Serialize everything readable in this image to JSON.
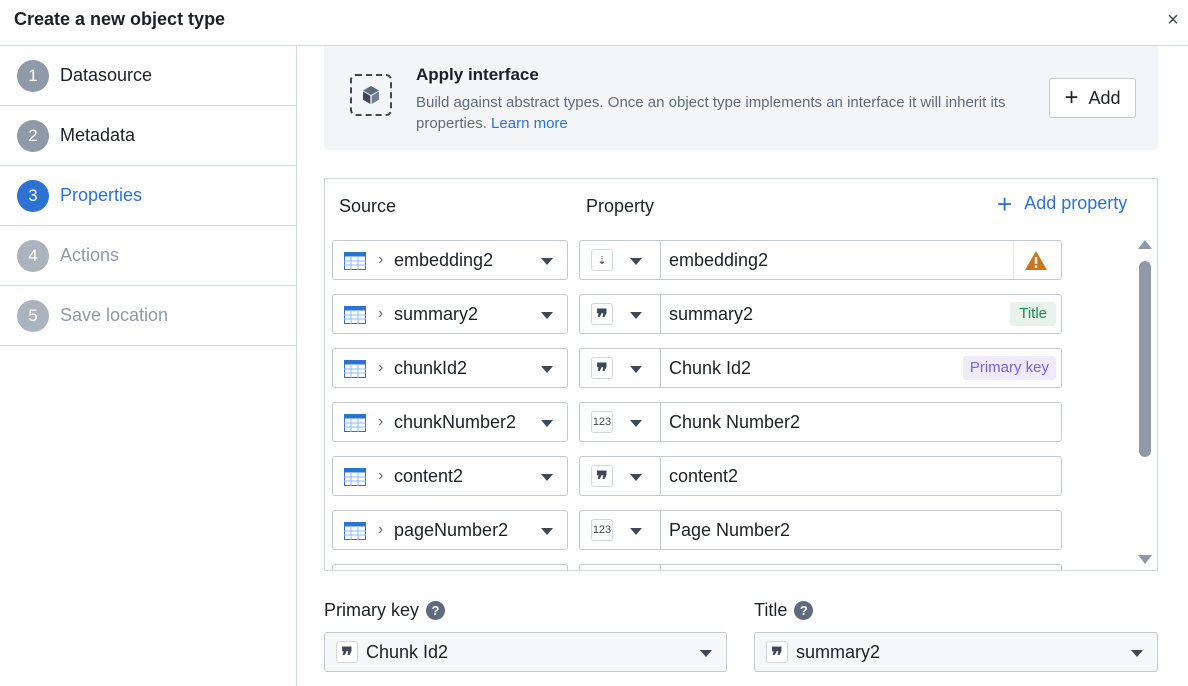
{
  "dialog": {
    "title": "Create a new object type",
    "close_glyph": "×"
  },
  "steps": [
    {
      "num": "1",
      "label": "Datasource",
      "state": "done"
    },
    {
      "num": "2",
      "label": "Metadata",
      "state": "done"
    },
    {
      "num": "3",
      "label": "Properties",
      "state": "active"
    },
    {
      "num": "4",
      "label": "Actions",
      "state": "disabled"
    },
    {
      "num": "5",
      "label": "Save location",
      "state": "disabled"
    }
  ],
  "interface": {
    "title": "Apply interface",
    "description": "Build against abstract types. Once an object type implements an interface it will inherit its properties.",
    "learn_more": "Learn more",
    "add_label": "Add"
  },
  "table": {
    "source_header": "Source",
    "property_header": "Property",
    "add_property_label": "Add property",
    "rows": [
      {
        "source": "embedding2",
        "type_icon": "vector-icon",
        "type_text": "⇣",
        "property": "embedding2",
        "badge": "warning"
      },
      {
        "source": "summary2",
        "type_icon": "string-icon",
        "type_text": "❞",
        "property": "summary2",
        "badge": "Title"
      },
      {
        "source": "chunkId2",
        "type_icon": "string-icon",
        "type_text": "❞",
        "property": "Chunk Id2",
        "badge": "Primary key"
      },
      {
        "source": "chunkNumber2",
        "type_icon": "number-icon",
        "type_text": "123",
        "property": "Chunk Number2",
        "badge": ""
      },
      {
        "source": "content2",
        "type_icon": "string-icon",
        "type_text": "❞",
        "property": "content2",
        "badge": ""
      },
      {
        "source": "pageNumber2",
        "type_icon": "number-icon",
        "type_text": "123",
        "property": "Page Number2",
        "badge": ""
      }
    ]
  },
  "primary_key": {
    "label": "Primary key",
    "value": "Chunk Id2",
    "help": "?"
  },
  "title_field": {
    "label": "Title",
    "value": "summary2",
    "help": "?"
  },
  "colors": {
    "accent": "#2d72d2",
    "title_tag": "#238551",
    "pk_tag": "#7961db",
    "warning": "#c87619"
  }
}
